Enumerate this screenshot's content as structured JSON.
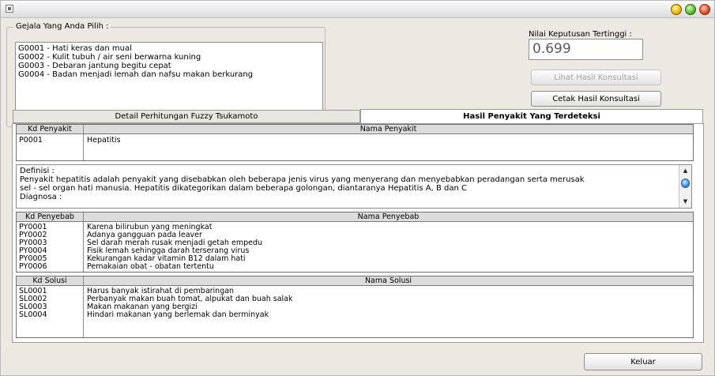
{
  "colors": {
    "window_bg": "#ece9e3",
    "header_bg": "#dcdcdc",
    "value_text": "#5a5a5a"
  },
  "symptoms_group": {
    "legend": "Gejala Yang Anda Pilih :",
    "items": [
      "G0001 - Hati keras dan mual",
      "G0002 - Kulit tubuh / air seni berwarna kuning",
      "G0003 - Debaran jantung begitu cepat",
      "G0004 - Badan menjadi lemah dan nafsu makan berkurang"
    ]
  },
  "decision": {
    "label": "Nilai Keputusan Tertinggi :",
    "value": "0.699"
  },
  "buttons": {
    "view_result": "Lihat Hasil Konsultasi",
    "print_result": "Cetak Hasil Konsultasi",
    "exit": "Keluar"
  },
  "tabs": [
    {
      "label": "Detail Perhitungan Fuzzy Tsukamoto",
      "active": false
    },
    {
      "label": "Hasil Penyakit Yang Terdeteksi",
      "active": true
    }
  ],
  "disease_table": {
    "columns": [
      "Kd Penyakit",
      "Nama Penyakit"
    ],
    "rows": [
      {
        "code": "P0001",
        "name": "Hepatitis"
      }
    ]
  },
  "definition": {
    "lines": [
      "Definisi :",
      "Penyakit hepatitis adalah penyakit yang disebabkan oleh beberapa jenis virus yang menyerang dan menyebabkan peradangan serta merusak",
      "sel - sel organ hati manusia. Hepatitis dikategorikan dalam beberapa golongan, diantaranya Hepatitis A, B dan C",
      "Diagnosa :"
    ]
  },
  "cause_table": {
    "columns": [
      "Kd Penyebab",
      "Nama Penyebab"
    ],
    "rows": [
      {
        "code": "PY0001",
        "name": "Karena bilirubun yang meningkat"
      },
      {
        "code": "PY0002",
        "name": "Adanya gangguan pada leaver"
      },
      {
        "code": "PY0003",
        "name": "Sel darah merah rusak menjadi getah empedu"
      },
      {
        "code": "PY0004",
        "name": "Fisik lemah sehingga darah terserang virus"
      },
      {
        "code": "PY0005",
        "name": "Kekurangan kadar vitamin B12 dalam hati"
      },
      {
        "code": "PY0006",
        "name": "Pemakaian obat - obatan tertentu"
      }
    ]
  },
  "solution_table": {
    "columns": [
      "Kd Solusi",
      "Nama Solusi"
    ],
    "rows": [
      {
        "code": "SL0001",
        "name": "Harus banyak istirahat di pembaringan"
      },
      {
        "code": "SL0002",
        "name": "Perbanyak makan buah tomat, alpukat dan buah salak"
      },
      {
        "code": "SL0003",
        "name": "Makan makanan yang bergizi"
      },
      {
        "code": "SL0004",
        "name": "Hindari makanan yang berlemak dan berminyak"
      }
    ]
  }
}
